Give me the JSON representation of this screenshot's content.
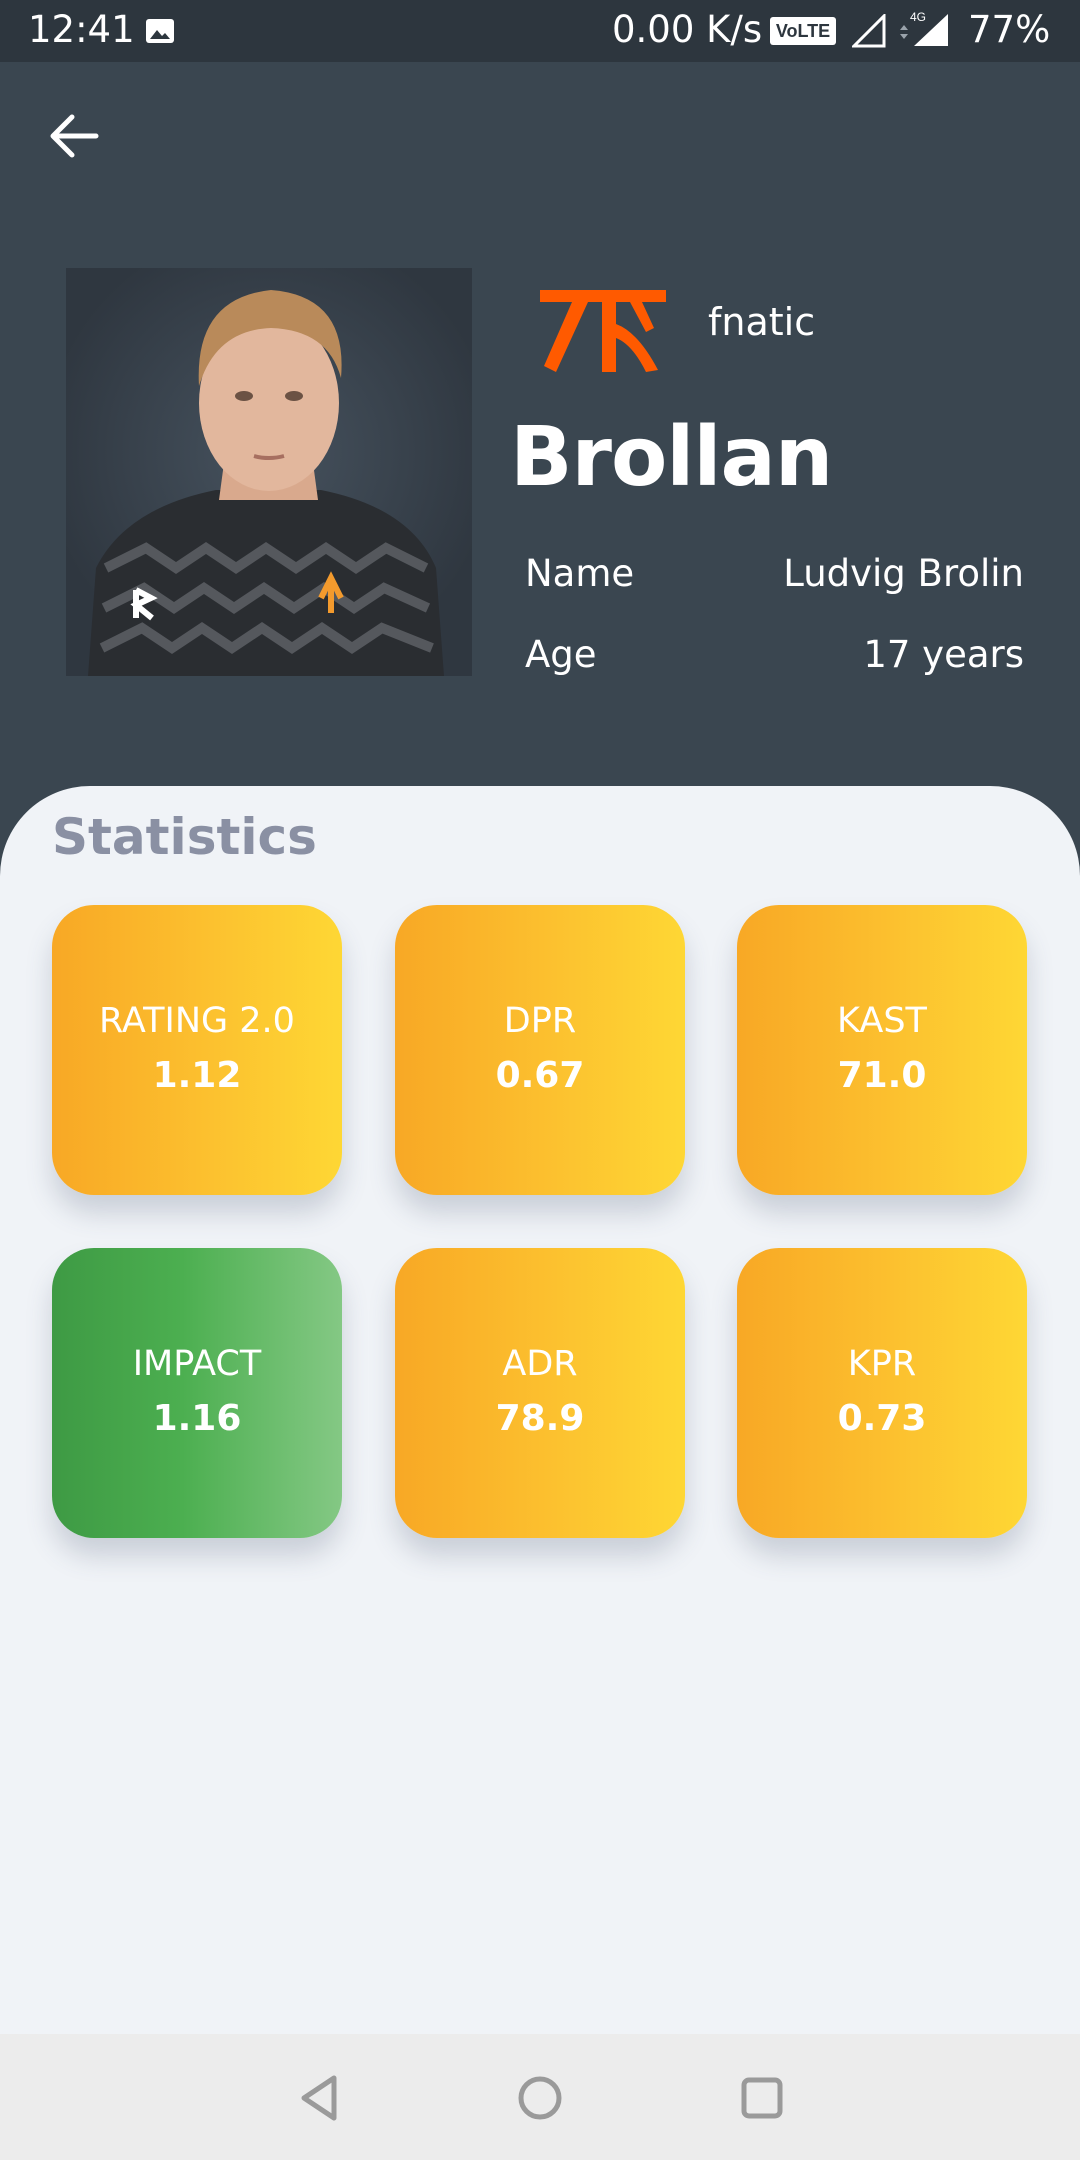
{
  "status_bar": {
    "time": "12:41",
    "net_speed": "0.00 K/s",
    "volte": "VoLTE",
    "network": "4G",
    "battery": "77%"
  },
  "header": {
    "back_icon": "arrow-left-icon",
    "team_name": "fnatic",
    "player_tag": "Brollan",
    "info": [
      {
        "label": "Name",
        "value": "Ludvig Brolin"
      },
      {
        "label": "Age",
        "value": "17 years"
      }
    ]
  },
  "statistics": {
    "title": "Statistics",
    "cards": [
      {
        "label": "RATING 2.0",
        "value": "1.12",
        "color": "#fbb82c"
      },
      {
        "label": "DPR",
        "value": "0.67",
        "color": "#fbb82c"
      },
      {
        "label": "KAST",
        "value": "71.0",
        "color": "#fbb82c"
      },
      {
        "label": "IMPACT",
        "value": "1.16",
        "color": "#4caf50"
      },
      {
        "label": "ADR",
        "value": "78.9",
        "color": "#fbb82c"
      },
      {
        "label": "KPR",
        "value": "0.73",
        "color": "#fbb82c"
      }
    ]
  },
  "colors": {
    "header_bg": "#3a4650",
    "panel_bg": "#f0f3f7",
    "team_logo": "#ff5a00",
    "title_grey": "#8a90a3"
  },
  "nav_bar": {
    "icons": [
      "triangle-back-icon",
      "circle-home-icon",
      "square-recents-icon"
    ]
  }
}
